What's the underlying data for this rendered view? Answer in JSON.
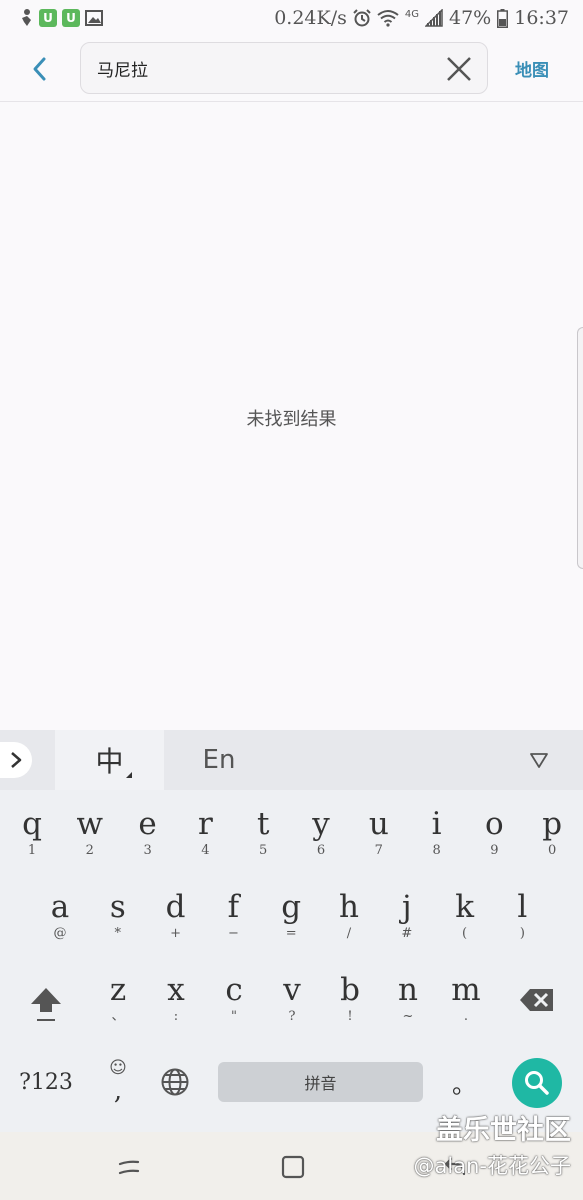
{
  "status_bar": {
    "network_speed": "0.24K/s",
    "network_type": "4G",
    "battery": "47%",
    "time": "16:37",
    "icons": [
      "notification-icon",
      "app-badge-icon",
      "app-badge-icon",
      "image-icon",
      "alarm-icon",
      "wifi-icon",
      "signal-icon",
      "battery-icon"
    ]
  },
  "header": {
    "back_icon": "chevron-left-icon",
    "search_value": "马尼拉",
    "clear_icon": "close-icon",
    "map_label": "地图"
  },
  "main": {
    "empty_message": "未找到结果"
  },
  "keyboard": {
    "expand_icon": "chevron-right-icon",
    "tab_zh": "中",
    "tab_en": "En",
    "collapse_icon": "triangle-down-icon",
    "row1": [
      {
        "key": "q",
        "sub": "1"
      },
      {
        "key": "w",
        "sub": "2"
      },
      {
        "key": "e",
        "sub": "3"
      },
      {
        "key": "r",
        "sub": "4"
      },
      {
        "key": "t",
        "sub": "5"
      },
      {
        "key": "y",
        "sub": "6"
      },
      {
        "key": "u",
        "sub": "7"
      },
      {
        "key": "i",
        "sub": "8"
      },
      {
        "key": "o",
        "sub": "9"
      },
      {
        "key": "p",
        "sub": "0"
      }
    ],
    "row2": [
      {
        "key": "a",
        "sub": "@"
      },
      {
        "key": "s",
        "sub": "*"
      },
      {
        "key": "d",
        "sub": "+"
      },
      {
        "key": "f",
        "sub": "−"
      },
      {
        "key": "g",
        "sub": "="
      },
      {
        "key": "h",
        "sub": "/"
      },
      {
        "key": "j",
        "sub": "#"
      },
      {
        "key": "k",
        "sub": "("
      },
      {
        "key": "l",
        "sub": ")"
      }
    ],
    "row3": [
      {
        "key": "z",
        "sub": "、"
      },
      {
        "key": "x",
        "sub": ":"
      },
      {
        "key": "c",
        "sub": "\""
      },
      {
        "key": "v",
        "sub": "?"
      },
      {
        "key": "b",
        "sub": "!"
      },
      {
        "key": "n",
        "sub": "~"
      },
      {
        "key": "m",
        "sub": "."
      }
    ],
    "shift_icon": "shift-icon",
    "backspace_icon": "backspace-icon",
    "symbols_label": "?123",
    "emoji_label": "☺",
    "comma_label": ",",
    "globe_icon": "globe-icon",
    "space_label": "拼音",
    "period_label": "。",
    "search_icon": "search-icon",
    "accent_color": "#1fb8a4"
  },
  "nav_bar": {
    "recents_icon": "recents-icon",
    "home_icon": "home-icon",
    "back_icon": "back-arrow-icon"
  },
  "watermark": {
    "line1": "盖乐世社区",
    "line2": "@alan-花花公子"
  }
}
